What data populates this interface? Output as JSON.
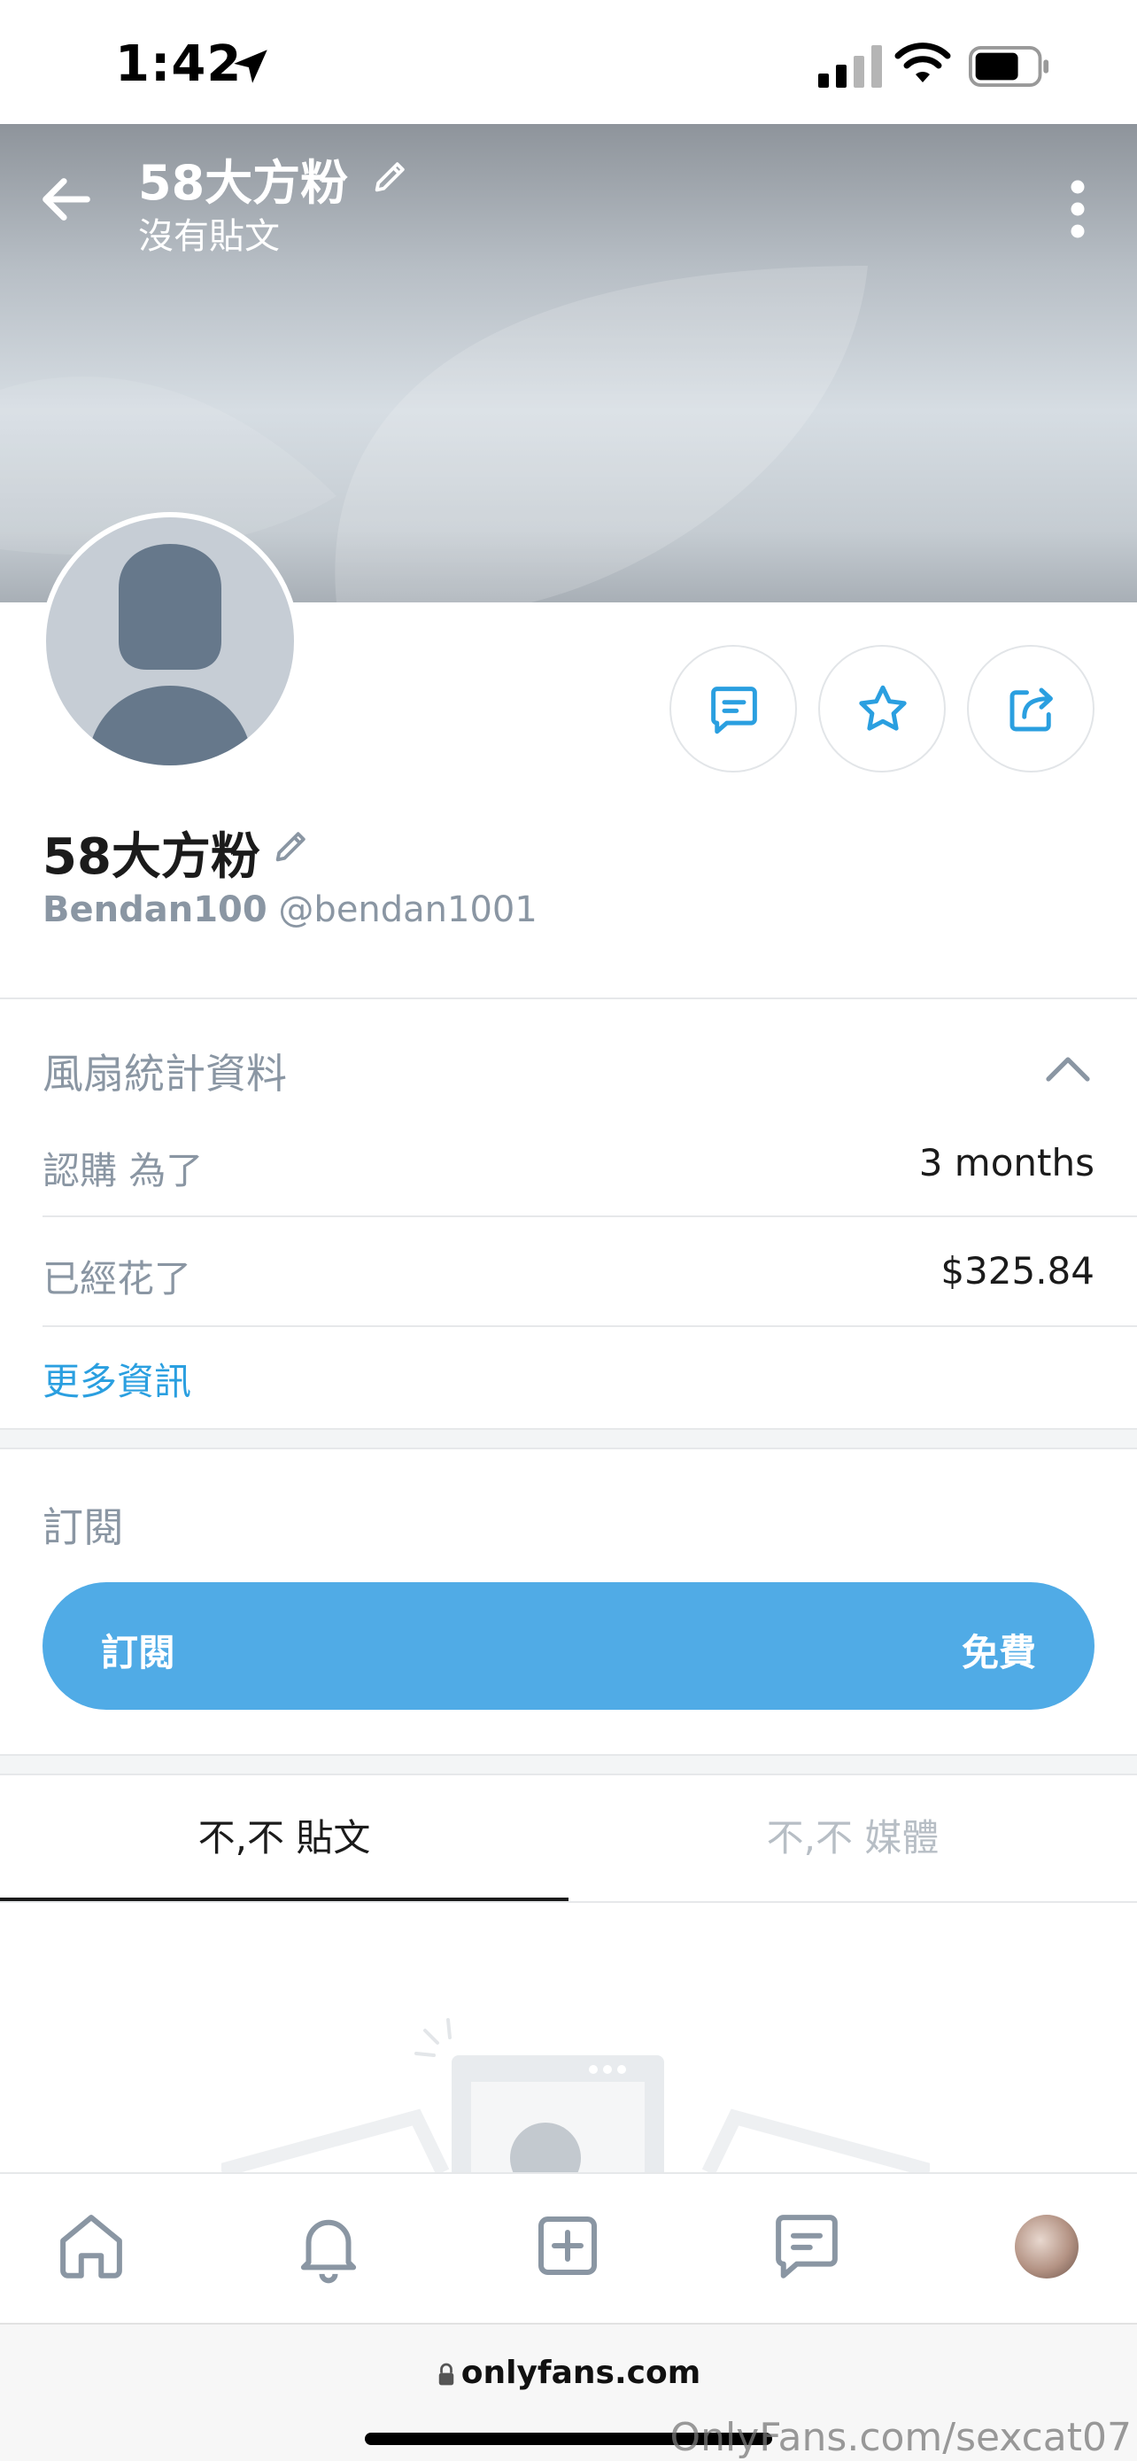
{
  "status_bar": {
    "time": "1:42"
  },
  "header": {
    "name": "58大方粉",
    "subtitle": "沒有貼文"
  },
  "profile": {
    "name": "58大方粉",
    "display_name": "Bendan100",
    "handle": "@bendan1001"
  },
  "fan_stats": {
    "title": "風扇統計資料",
    "rows": [
      {
        "label": "認購 為了",
        "value": "3 months"
      },
      {
        "label": "已經花了",
        "value": "$325.84"
      }
    ],
    "more_link": "更多資訊"
  },
  "subscription": {
    "title": "訂閱",
    "button_label": "訂閱",
    "button_price": "免費"
  },
  "tabs": [
    {
      "label": "不,不 貼文",
      "active": true
    },
    {
      "label": "不,不 媒體",
      "active": false
    }
  ],
  "browser": {
    "url": "onlyfans.com"
  },
  "watermark": "OnlyFans.com/sexcat07",
  "colors": {
    "accent": "#50abe6",
    "link": "#2a9fe0",
    "muted": "#8a96a3"
  },
  "icons": [
    "location-arrow-icon",
    "signal-icon",
    "wifi-icon",
    "battery-icon",
    "back-arrow-icon",
    "edit-pencil-icon",
    "more-vertical-icon",
    "message-icon",
    "star-icon",
    "share-icon",
    "chevron-up-icon",
    "home-icon",
    "bell-icon",
    "add-post-icon",
    "chat-icon",
    "lock-icon"
  ]
}
